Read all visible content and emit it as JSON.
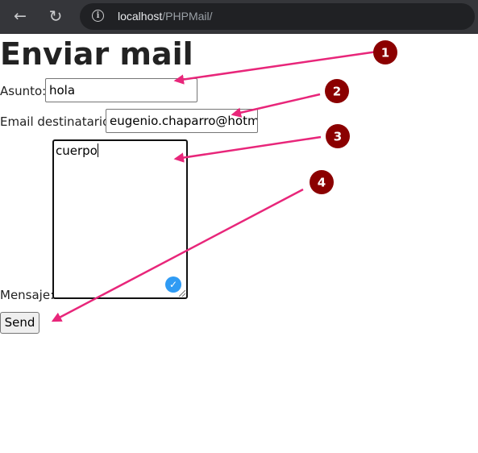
{
  "browser": {
    "url_host": "localhost",
    "url_path": "/PHPMail/",
    "back_icon": "arrow-left-icon",
    "reload_icon": "reload-icon",
    "info_icon": "info-icon"
  },
  "page": {
    "title": "Enviar mail",
    "subject_label": "Asunto:",
    "subject_value": "hola",
    "email_label": "Email destinatario:",
    "email_value": "eugenio.chaparro@hotmail.com",
    "message_label": "Mensaje:",
    "message_value": "cuerpo",
    "send_label": "Send"
  },
  "annotations": {
    "badges": [
      "1",
      "2",
      "3",
      "4"
    ],
    "badge_color": "#8b0000",
    "arrow_color": "#e8267a"
  }
}
